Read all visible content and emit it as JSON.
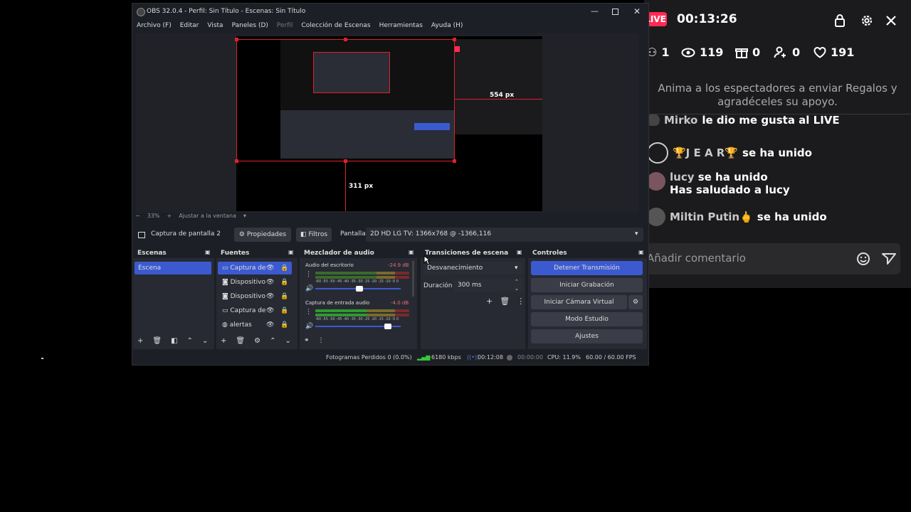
{
  "tiktok": {
    "live_badge": "LIVE",
    "timer": "00:13:26",
    "stats": {
      "users": "1",
      "views": "119",
      "gifts": "0",
      "follows": "0",
      "likes": "191"
    },
    "message": "Anima a los espectadores a enviar Regalos y agradéceles su apoyo.",
    "chat": [
      {
        "user": "Mirko",
        "action": "le dio me gusta al LIVE"
      },
      {
        "user": "🏆J E A R🏆",
        "action": "se ha unido"
      },
      {
        "user": "lucy",
        "action": "se ha unido",
        "sub": "Has saludado a lucy"
      },
      {
        "user": "Miltin Putin🖕",
        "action": "se ha unido"
      }
    ],
    "comment_placeholder": "Añadir comentario"
  },
  "obs": {
    "title": "OBS 32.0.4 - Perfil: Sin Título - Escenas: Sin Título",
    "menu": [
      "Archivo (F)",
      "Editar",
      "Vista",
      "Paneles (D)",
      "Perfil",
      "Colección de Escenas",
      "Herramientas",
      "Ayuda (H)"
    ],
    "preview_labels": {
      "width_px": "554 px",
      "height_px": "311 px"
    },
    "zoom": {
      "minus": "−",
      "value": "33%",
      "plus": "+",
      "fit": "Ajustar a la ventana"
    },
    "source_bar": {
      "source_name": "Captura de pantalla 2",
      "properties": "Propiedades",
      "filters": "Filtros",
      "screen_label": "Pantalla",
      "screen_value": "2D HD LG TV: 1366x768 @ -1366,116"
    },
    "docks": {
      "scenes": {
        "title": "Escenas",
        "items": [
          "Escena"
        ]
      },
      "sources": {
        "title": "Fuentes",
        "items": [
          "Captura de",
          "Dispositivo",
          "Dispositivo",
          "Captura de",
          "alertas"
        ]
      },
      "mixer": {
        "title": "Mezclador de audio",
        "tracks": [
          {
            "name": "Audio del escritorio",
            "db": "-24.9 dB",
            "level": 0.65
          },
          {
            "name": "Captura de entrada audio",
            "db": "-4.0 dB",
            "level": 0.8
          }
        ],
        "scale": "-60 -55 -50 -45 -40 -35 -30 -25 -20 -15 -10 -5 0"
      },
      "transitions": {
        "title": "Transiciones de escena",
        "transition": "Desvanecimiento",
        "duration_label": "Duración",
        "duration_value": "300 ms"
      },
      "controls": {
        "title": "Controles",
        "buttons": [
          "Detener Transmisión",
          "Iniciar Grabación",
          "Iniciar Cámara Virtual",
          "Modo Estudio",
          "Ajustes"
        ]
      }
    },
    "status": {
      "dropped": "Fotogramas Perdidos 0 (0.0%)",
      "bitrate": "6180 kbps",
      "live_time": "00:12:08",
      "rec_time": "00:00:00",
      "cpu": "CPU: 11.9%",
      "fps": "60.00 / 60.00 FPS"
    },
    "colors": {
      "accent": "#3c5ad0",
      "red": "#e0202c",
      "live": "#fe2c55"
    }
  }
}
